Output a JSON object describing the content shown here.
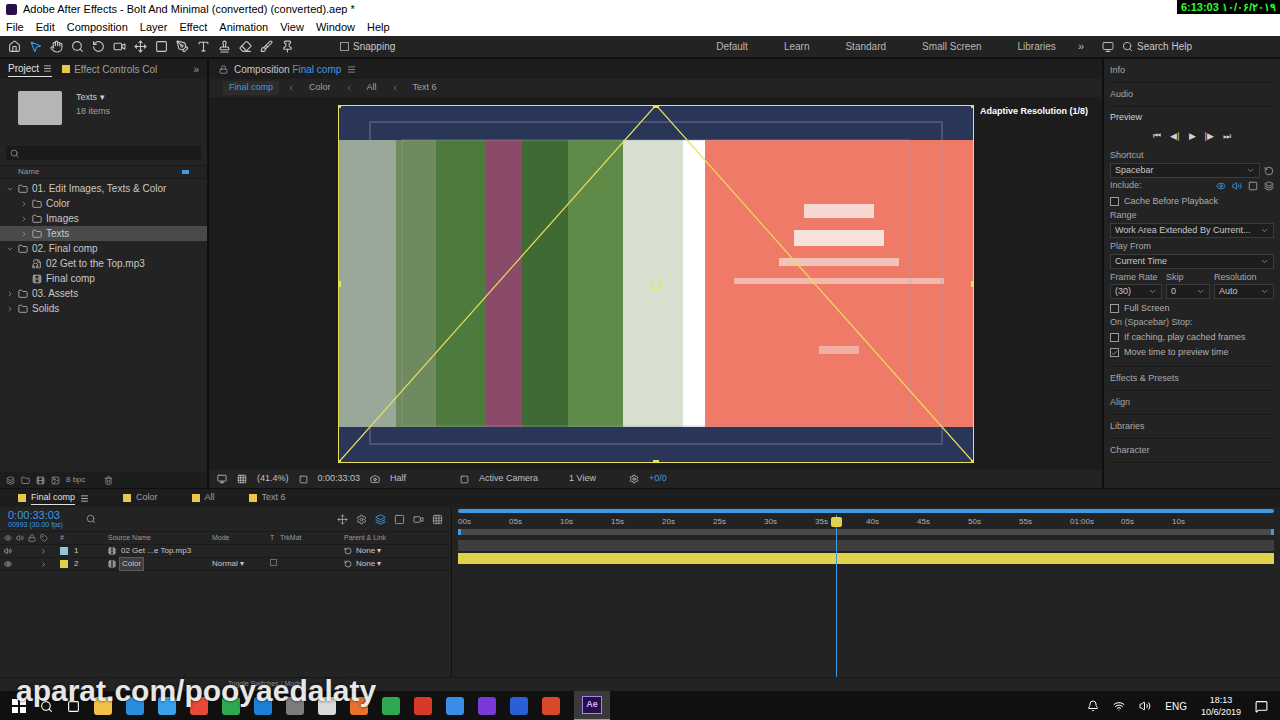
{
  "window": {
    "title": "Adobe After Effects - Bolt And Minimal (converted) (converted).aep *"
  },
  "clock_overlay": "6:13:03 ۱۰/۰۶/۲۰۱۹",
  "menu": [
    "File",
    "Edit",
    "Composition",
    "Layer",
    "Effect",
    "Animation",
    "View",
    "Window",
    "Help"
  ],
  "toolbar": {
    "snapping": {
      "label": "Snapping",
      "checked": false
    },
    "workspaces": [
      "Default",
      "Learn",
      "Standard",
      "Small Screen",
      "Libraries"
    ],
    "more": "»",
    "search": {
      "placeholder": "Search Help"
    }
  },
  "project": {
    "tabs": [
      {
        "label": "Project",
        "selected": true
      },
      {
        "label": "Effect Controls Col",
        "selected": false
      }
    ],
    "more": "»",
    "preview": {
      "name": "Texts",
      "arrow": "▾",
      "count": "18 items"
    },
    "column": "Name",
    "items": [
      {
        "label": "01. Edit Images, Texts & Color",
        "kind": "folder",
        "expanded": true,
        "selected": false,
        "children": [
          {
            "label": "Color",
            "kind": "folder",
            "expanded": false,
            "selected": false,
            "children": []
          },
          {
            "label": "Images",
            "kind": "folder",
            "expanded": false,
            "selected": false,
            "children": []
          },
          {
            "label": "Texts",
            "kind": "folder",
            "expanded": false,
            "selected": true,
            "children": []
          }
        ]
      },
      {
        "label": "02. Final comp",
        "kind": "folder",
        "expanded": true,
        "selected": false,
        "children": [
          {
            "label": "02 Get to the Top.mp3",
            "kind": "audio",
            "expanded": false,
            "selected": false,
            "children": []
          },
          {
            "label": "Final comp",
            "kind": "comp",
            "expanded": false,
            "selected": false,
            "children": []
          }
        ]
      },
      {
        "label": "03. Assets",
        "kind": "folder",
        "expanded": false,
        "selected": false,
        "children": []
      },
      {
        "label": "Solids",
        "kind": "folder",
        "expanded": false,
        "selected": false,
        "children": []
      }
    ],
    "bpc": "8 bpc"
  },
  "composition": {
    "tab": "Composition",
    "comp_name": "Final comp",
    "breadcrumbs": [
      {
        "label": "Final comp",
        "selected": true
      },
      {
        "label": "Color",
        "selected": false
      },
      {
        "label": "All",
        "selected": false
      },
      {
        "label": "Text 6",
        "selected": false
      }
    ],
    "overlay": "Adaptive Resolution (1/8)",
    "footer": {
      "zoom": "(41.4%)",
      "time": "0:00:33:03",
      "resolution": "Half",
      "camera": "Active Camera",
      "views": "1 View",
      "exposure": "+0/0"
    }
  },
  "right_panel": {
    "collapsed_top": [
      "Info",
      "Audio"
    ],
    "preview": {
      "title": "Preview",
      "controls": [
        "⏮",
        "◀|",
        "▶",
        "|▶",
        "⏭"
      ],
      "shortcut_label": "Shortcut",
      "shortcut": "Spacebar",
      "include_label": "Include:",
      "cache": {
        "label": "Cache Before Playback",
        "checked": false
      },
      "range_label": "Range",
      "range": "Work Area Extended By Current...",
      "play_from_label": "Play From",
      "play_from": "Current Time",
      "fields": [
        {
          "label": "Frame Rate",
          "value": "(30)"
        },
        {
          "label": "Skip",
          "value": "0"
        },
        {
          "label": "Resolution",
          "value": "Auto"
        }
      ],
      "full_screen": {
        "label": "Full Screen",
        "checked": false
      },
      "stop_label": "On (Spacebar) Stop:",
      "stop_options": [
        {
          "label": "If caching, play cached frames",
          "checked": false
        },
        {
          "label": "Move time to preview time",
          "checked": true
        }
      ]
    },
    "sections": [
      "Effects & Presets",
      "Align",
      "Libraries",
      "Character"
    ]
  },
  "timeline": {
    "tabs": [
      {
        "label": "Final comp",
        "selected": true
      },
      {
        "label": "Color",
        "selected": false
      },
      {
        "label": "All",
        "selected": false
      },
      {
        "label": "Text 6",
        "selected": false
      }
    ],
    "time": "0:00:33:03",
    "frame": "00993 (30.00 fps)",
    "columns": {
      "number": "#",
      "source": "Source Name",
      "mode": "Mode",
      "t": "T",
      "trkmat": "TrkMat",
      "parent": "Parent & Link"
    },
    "ruler": [
      "00s",
      "05s",
      "10s",
      "15s",
      "20s",
      "25s",
      "30s",
      "35s",
      "40s",
      "45s",
      "50s",
      "55s",
      "01:00s",
      "05s",
      "10s"
    ],
    "playhead": 0.463,
    "layers": [
      {
        "number": "1",
        "name": "02 Get ...e Top.mp3",
        "mode": "",
        "parent": "None",
        "selected": false,
        "color": "#8fc7d6"
      },
      {
        "number": "2",
        "name": "Color",
        "mode": "Normal",
        "parent": "None",
        "selected": true,
        "color": "#e0d24a"
      }
    ],
    "footer": "Toggle Switches / Modes"
  },
  "taskbar": {
    "active_app": "Ae",
    "language": "ENG",
    "time": "18:13",
    "date": "10/6/2019"
  },
  "watermark": "aparat.com/pooyaedalaty"
}
